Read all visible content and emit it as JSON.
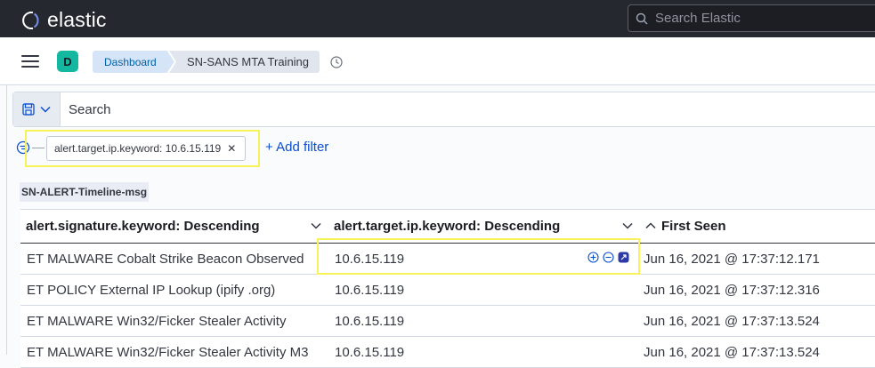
{
  "app": {
    "logo_text": "elastic"
  },
  "header": {
    "search_placeholder": "Search Elastic"
  },
  "secondary_bar": {
    "avatar_letter": "D",
    "breadcrumbs": [
      "Dashboard",
      "SN-SANS MTA Training"
    ]
  },
  "query": {
    "placeholder": "Search"
  },
  "filters": {
    "items": [
      {
        "label": "alert.target.ip.keyword: 10.6.15.119"
      }
    ],
    "add_label": "+ Add filter"
  },
  "panel": {
    "title": "SN-ALERT-Timeline-msg"
  },
  "table": {
    "columns": [
      "alert.signature.keyword: Descending",
      "alert.target.ip.keyword: Descending",
      "First Seen"
    ],
    "rows": [
      [
        "ET MALWARE Cobalt Strike Beacon Observed",
        "10.6.15.119",
        "Jun 16, 2021 @ 17:37:12.171"
      ],
      [
        "ET POLICY External IP Lookup (ipify .org)",
        "10.6.15.119",
        "Jun 16, 2021 @ 17:37:12.316"
      ],
      [
        "ET MALWARE Win32/Ficker Stealer Activity",
        "10.6.15.119",
        "Jun 16, 2021 @ 17:37:13.524"
      ],
      [
        "ET MALWARE Win32/Ficker Stealer Activity M3",
        "10.6.15.119",
        "Jun 16, 2021 @ 17:37:13.524"
      ]
    ]
  },
  "colors": {
    "header_bg": "#25282f",
    "accent": "#0a4ed0",
    "highlight": "#f7f25a",
    "avatar": "#14b8a0"
  }
}
